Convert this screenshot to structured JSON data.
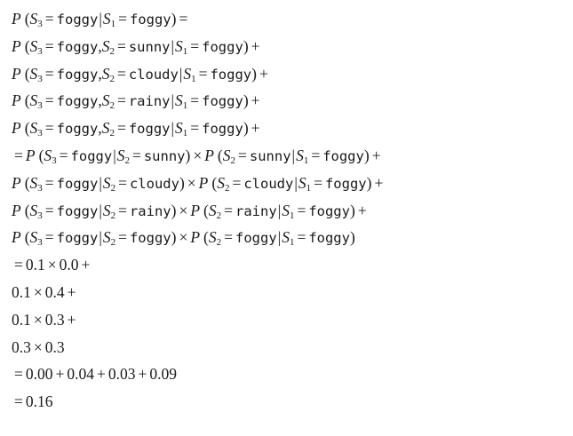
{
  "derivation": {
    "lines": [
      "P (S3 = foggy|S1 = foggy) =",
      "P (S3 = foggy, S2 = sunny|S1 = foggy) +",
      "P (S3 = foggy, S2 = cloudy|S1 = foggy) +",
      "P (S3 = foggy, S2 = rainy|S1 = foggy) +",
      "P (S3 = foggy, S2 = foggy|S1 = foggy) +",
      "= P (S3 = foggy|S2 = sunny) × P (S2 = sunny|S1 = foggy) +",
      "P (S3 = foggy|S2 = cloudy) × P (S2 = cloudy|S1 = foggy) +",
      "P (S3 = foggy|S2 = rainy) × P (S2 = rainy|S1 = foggy) +",
      "P (S3 = foggy|S2 = foggy) × P (S2 = foggy|S1 = foggy)",
      "= 0.1 × 0.0 +",
      "0.1 × 0.4 +",
      "0.1 × 0.3 +",
      "0.3 × 0.3",
      "= 0.00 + 0.04 + 0.03 + 0.09",
      "= 0.16"
    ],
    "text_color": "#1a1a1a",
    "background_color": "#ffffff"
  }
}
